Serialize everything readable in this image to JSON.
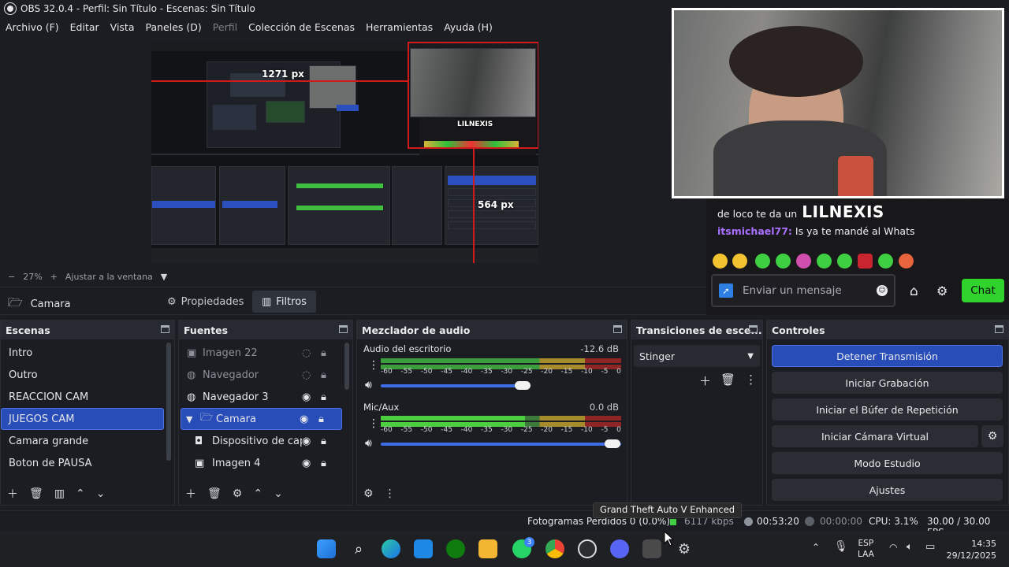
{
  "window": {
    "title": "OBS 32.0.4 - Perfil: Sin Título - Escenas: Sin Título"
  },
  "menu": [
    {
      "label": "Archivo (F)",
      "disabled": false
    },
    {
      "label": "Editar",
      "disabled": false
    },
    {
      "label": "Vista",
      "disabled": false
    },
    {
      "label": "Paneles (D)",
      "disabled": false
    },
    {
      "label": "Perfil",
      "disabled": true
    },
    {
      "label": "Colección de Escenas",
      "disabled": false
    },
    {
      "label": "Herramientas",
      "disabled": false
    },
    {
      "label": "Ayuda (H)",
      "disabled": false
    }
  ],
  "preview": {
    "width_label": "1271 px",
    "height_label": "564 px",
    "nested_overlay_name": "LILNEXIS"
  },
  "zoom": {
    "minus": "−",
    "value": "27%",
    "plus": "+",
    "fit_label": "Ajustar a la ventana"
  },
  "scene_bar": {
    "current_source": "Camara",
    "properties_label": "Propiedades",
    "filters_label": "Filtros"
  },
  "chat": {
    "line1_prefix": "de loco te da un",
    "line1_big": "LILNEXIS",
    "line2_user": "itsmichael77:",
    "line2_text": " Is ya te mandé al Whats",
    "input_placeholder": "Enviar un mensaje",
    "chat_button": "Chat",
    "accent": "#30d32c",
    "username_color": "#a970ff"
  },
  "docks": {
    "scenes": {
      "title": "Escenas",
      "items": [
        "Intro",
        "Outro",
        "REACCION CAM",
        "JUEGOS CAM",
        "Camara grande",
        "Boton de PAUSA"
      ],
      "selected": "JUEGOS CAM"
    },
    "sources": {
      "title": "Fuentes",
      "items": [
        {
          "label": "Imagen 22",
          "icon": "image-icon",
          "visible": false
        },
        {
          "label": "Navegador",
          "icon": "globe-icon",
          "visible": false
        },
        {
          "label": "Navegador 3",
          "icon": "globe-icon",
          "visible": true
        },
        {
          "label": "Camara",
          "icon": "folder-icon",
          "visible": true
        },
        {
          "label": "Dispositivo de captu",
          "icon": "camera-icon",
          "visible": true
        },
        {
          "label": "Imagen 4",
          "icon": "image-icon",
          "visible": true
        }
      ],
      "selected": "Camara"
    },
    "mixer": {
      "title": "Mezclador de audio",
      "channels": [
        {
          "name": "Audio del escritorio",
          "db": "-12.6 dB",
          "volume": 0.86
        },
        {
          "name": "Mic/Aux",
          "db": "0.0 dB",
          "volume": 1.0
        }
      ],
      "scale": [
        "-60",
        "-55",
        "-50",
        "-45",
        "-40",
        "-35",
        "-30",
        "-25",
        "-20",
        "-15",
        "-10",
        "-5",
        "0"
      ]
    },
    "transitions": {
      "title": "Transiciones de esce...",
      "selected": "Stinger"
    },
    "controls": {
      "title": "Controles",
      "buttons": [
        "Detener Transmisión",
        "Iniciar Grabación",
        "Iniciar el Búfer de Repetición",
        "Iniciar Cámara Virtual",
        "Modo Estudio",
        "Ajustes"
      ],
      "active_color": "#284cb8"
    }
  },
  "status": {
    "dropped_frames": "Fotogramas Perdidos 0 (0.0%)",
    "bitrate": "6117 kbps",
    "stream_time": "00:53:20",
    "record_time": "00:00:00",
    "cpu": "CPU: 3.1%",
    "fps": "30.00 / 30.00 FPS"
  },
  "tooltip": "Grand Theft Auto V Enhanced",
  "taskbar": {
    "lang1": "ESP",
    "lang2": "LAA",
    "time": "14:35",
    "date": "29/12/2025",
    "whatsapp_badge": "3"
  }
}
